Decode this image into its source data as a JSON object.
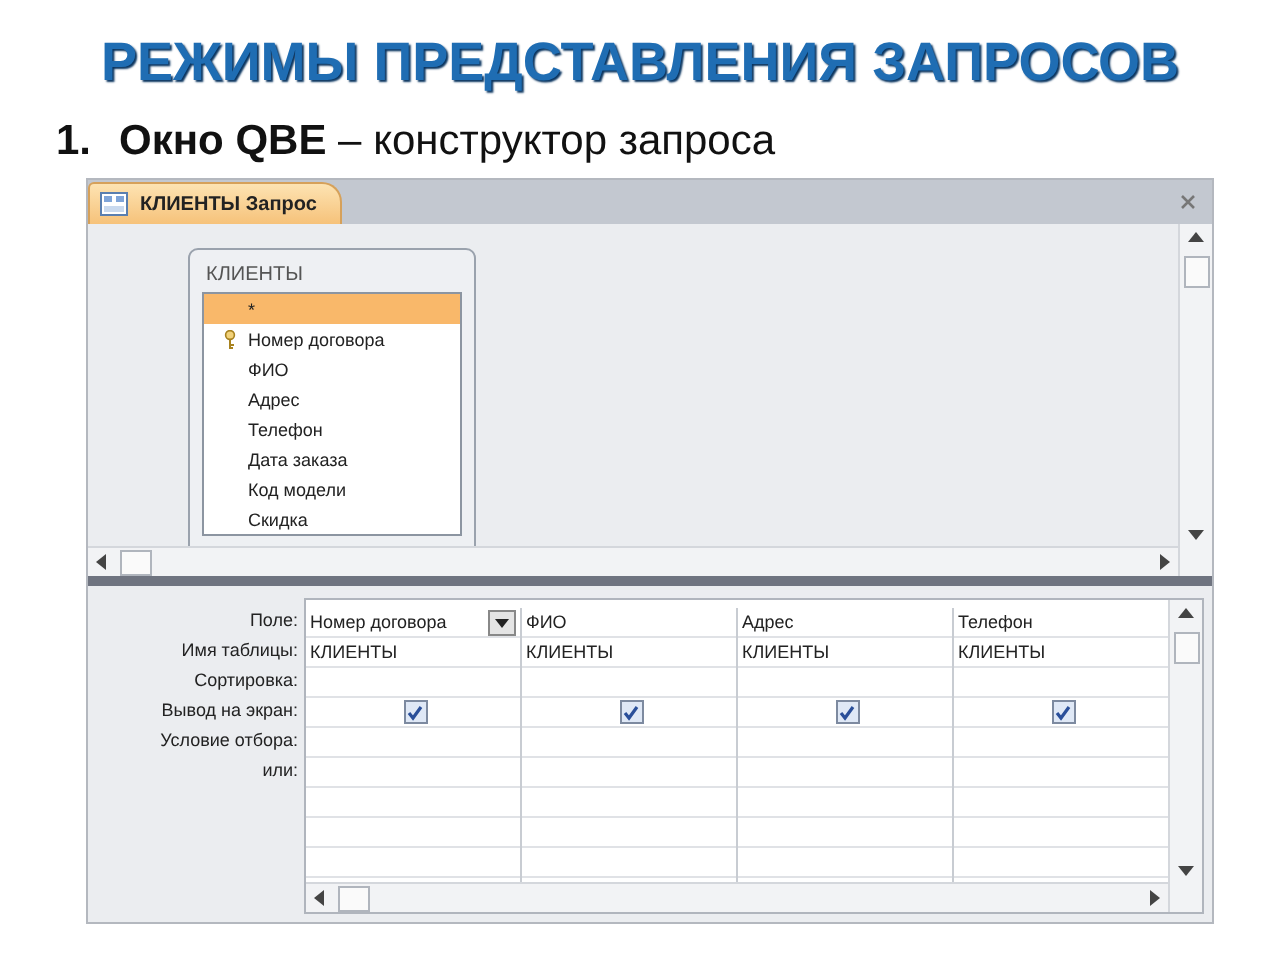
{
  "slide": {
    "title": "РЕЖИМЫ ПРЕДСТАВЛЕНИЯ ЗАПРОСОВ",
    "point_number": "1.",
    "point_text": "**Окно QBE** – конструктор запроса"
  },
  "window": {
    "tab": "КЛИЕНТЫ Запрос",
    "table": {
      "name": "КЛИЕНТЫ",
      "fields": [
        {
          "name": "*",
          "selected": true,
          "key": false
        },
        {
          "name": "Номер договора",
          "selected": false,
          "key": true
        },
        {
          "name": "ФИО",
          "selected": false,
          "key": false
        },
        {
          "name": "Адрес",
          "selected": false,
          "key": false
        },
        {
          "name": "Телефон",
          "selected": false,
          "key": false
        },
        {
          "name": "Дата заказа",
          "selected": false,
          "key": false
        },
        {
          "name": "Код модели",
          "selected": false,
          "key": false
        },
        {
          "name": "Скидка",
          "selected": false,
          "key": false
        }
      ]
    },
    "grid": {
      "row_labels": [
        "Поле:",
        "Имя таблицы:",
        "Сортировка:",
        "Вывод на экран:",
        "Условие отбора:",
        "или:"
      ],
      "columns": [
        {
          "field": "Номер договора",
          "table": "КЛИЕНТЫ",
          "show": true,
          "selected": true
        },
        {
          "field": "ФИО",
          "table": "КЛИЕНТЫ",
          "show": true,
          "selected": false
        },
        {
          "field": "Адрес",
          "table": "КЛИЕНТЫ",
          "show": true,
          "selected": false
        },
        {
          "field": "Телефон",
          "table": "КЛИЕНТЫ",
          "show": true,
          "selected": false
        }
      ]
    }
  }
}
